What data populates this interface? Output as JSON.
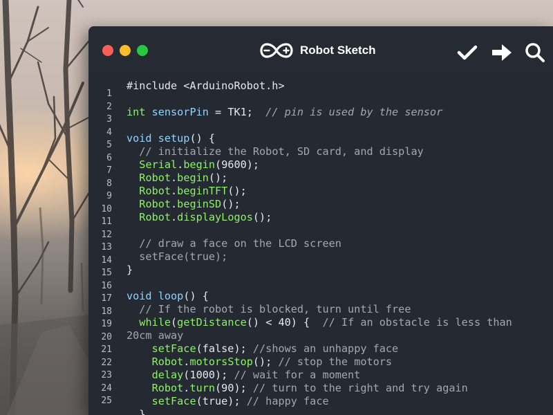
{
  "window": {
    "title": "Robot Sketch",
    "colors": {
      "background": "#252a32",
      "close": "#fc5f57",
      "minimize": "#fdbb2e",
      "maximize": "#27c840",
      "plain": "#e6e8eb",
      "type": "#8df265",
      "identifier": "#8fd3ff",
      "function": "#8df265",
      "comment": "#a3a8b0",
      "keyword": "#8fd3ff",
      "number": "#ffffff"
    },
    "logo_icon": "arduino-infinity-logo",
    "toolbar": {
      "verify_icon": "checkmark-icon",
      "upload_icon": "right-arrow-icon",
      "search_icon": "search-icon"
    }
  },
  "editor": {
    "line_numbers": [
      "1",
      "2",
      "3",
      "4",
      "5",
      "6",
      "7",
      "8",
      "9",
      "10",
      "11",
      "12",
      "13",
      "14",
      "15",
      "16",
      "17",
      "18",
      "19",
      "20",
      "21",
      "22",
      "23",
      "24",
      "25"
    ],
    "lines": [
      [
        [
          "#include <ArduinoRobot.h>",
          "plain"
        ]
      ],
      [],
      [
        [
          "int",
          "type"
        ],
        [
          " ",
          "plain"
        ],
        [
          "sensorPin",
          "identifier"
        ],
        [
          " = TK1;  ",
          "plain"
        ],
        [
          "// pin is used by the sensor",
          "comment"
        ]
      ],
      [],
      [
        [
          "void",
          "keyword"
        ],
        [
          " ",
          "plain"
        ],
        [
          "setup",
          "identifier"
        ],
        [
          "() {",
          "plain"
        ]
      ],
      [
        [
          "  ",
          "plain"
        ],
        [
          "// initialize the Robot, SD card, and display",
          "comment"
        ]
      ],
      [
        [
          "  ",
          "plain"
        ],
        [
          "Serial",
          "function"
        ],
        [
          ".",
          "plain"
        ],
        [
          "begin",
          "function"
        ],
        [
          "(9600);",
          "plain"
        ]
      ],
      [
        [
          "  ",
          "plain"
        ],
        [
          "Robot",
          "function"
        ],
        [
          ".",
          "plain"
        ],
        [
          "begin",
          "function"
        ],
        [
          "();",
          "plain"
        ]
      ],
      [
        [
          "  ",
          "plain"
        ],
        [
          "Robot",
          "function"
        ],
        [
          ".",
          "plain"
        ],
        [
          "beginTFT",
          "function"
        ],
        [
          "();",
          "plain"
        ]
      ],
      [
        [
          "  ",
          "plain"
        ],
        [
          "Robot",
          "function"
        ],
        [
          ".",
          "plain"
        ],
        [
          "beginSD",
          "function"
        ],
        [
          "();",
          "plain"
        ]
      ],
      [
        [
          "  ",
          "plain"
        ],
        [
          "Robot",
          "function"
        ],
        [
          ".",
          "plain"
        ],
        [
          "displayLogos",
          "function"
        ],
        [
          "();",
          "plain"
        ]
      ],
      [],
      [
        [
          "  ",
          "plain"
        ],
        [
          "// draw a face on the LCD screen",
          "comment"
        ]
      ],
      [
        [
          "  setFace(true);",
          "comment"
        ]
      ],
      [
        [
          "}",
          "plain"
        ]
      ],
      [],
      [
        [
          "void",
          "keyword"
        ],
        [
          " ",
          "plain"
        ],
        [
          "loop",
          "identifier"
        ],
        [
          "() {",
          "plain"
        ]
      ],
      [
        [
          "  ",
          "plain"
        ],
        [
          "// If the robot is blocked, turn until free",
          "comment"
        ]
      ],
      [
        [
          "  ",
          "plain"
        ],
        [
          "while",
          "function"
        ],
        [
          "(",
          "plain"
        ],
        [
          "getDistance",
          "function"
        ],
        [
          "() < 40) {  ",
          "plain"
        ],
        [
          "// If an obstacle is less than",
          "comment"
        ]
      ],
      [
        [
          "20cm away",
          "comment"
        ]
      ],
      [
        [
          "    ",
          "plain"
        ],
        [
          "setFace",
          "function"
        ],
        [
          "(false); ",
          "plain"
        ],
        [
          "//shows an unhappy face",
          "comment"
        ]
      ],
      [
        [
          "    ",
          "plain"
        ],
        [
          "Robot",
          "function"
        ],
        [
          ".",
          "plain"
        ],
        [
          "motorsStop",
          "function"
        ],
        [
          "(); ",
          "plain"
        ],
        [
          "// stop the motors",
          "comment"
        ]
      ],
      [
        [
          "    ",
          "plain"
        ],
        [
          "delay",
          "function"
        ],
        [
          "(1000); ",
          "plain"
        ],
        [
          "// wait for a moment",
          "comment"
        ]
      ],
      [
        [
          "    ",
          "plain"
        ],
        [
          "Robot",
          "function"
        ],
        [
          ".",
          "plain"
        ],
        [
          "turn",
          "function"
        ],
        [
          "(90); ",
          "plain"
        ],
        [
          "// turn to the right and try again",
          "comment"
        ]
      ],
      [
        [
          "    ",
          "plain"
        ],
        [
          "setFace",
          "function"
        ],
        [
          "(true); ",
          "plain"
        ],
        [
          "// happy face",
          "comment"
        ]
      ],
      [
        [
          "  }",
          "plain"
        ]
      ]
    ]
  }
}
